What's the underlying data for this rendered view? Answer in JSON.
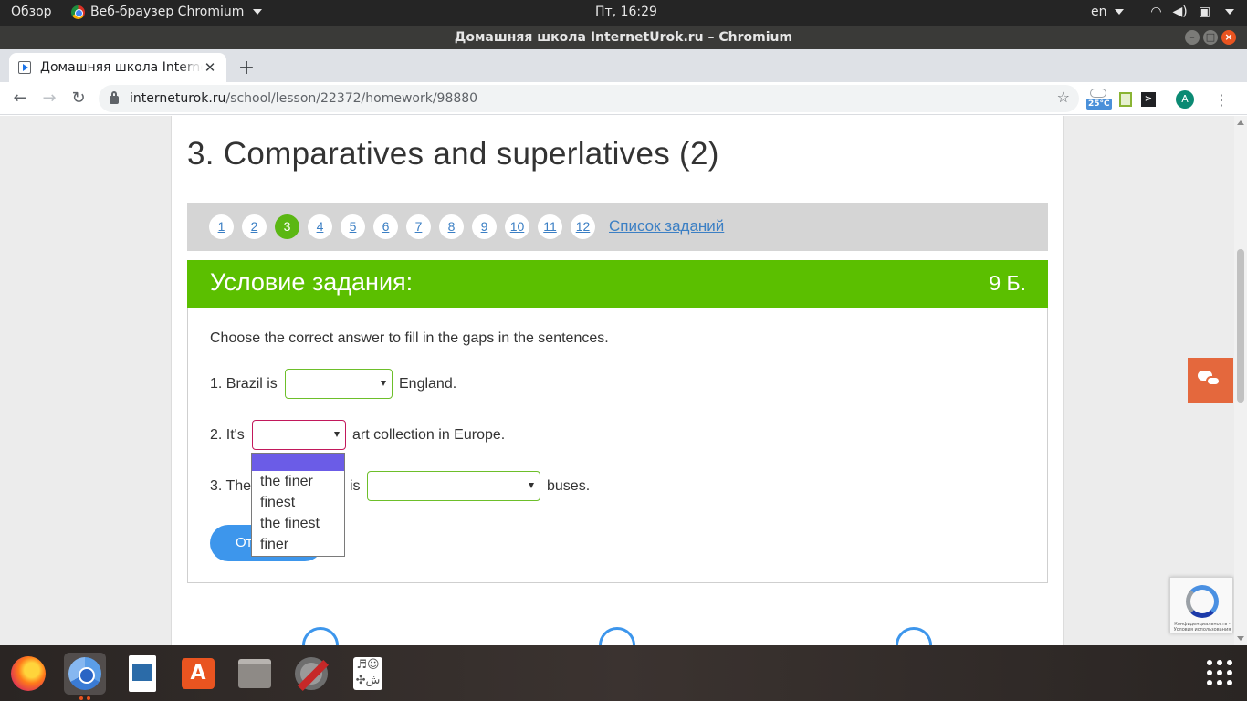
{
  "topbar": {
    "activities": "Обзор",
    "app_menu": "Веб-браузер Chromium",
    "clock": "Пт, 16:29",
    "lang": "en"
  },
  "window": {
    "title": "Домашняя школа InternetUrok.ru – Chromium"
  },
  "browser": {
    "tab_title": "Домашняя школа InternetUrok.ru",
    "url_host": "interneturok.ru",
    "url_path": "/school/lesson/22372/homework/98880",
    "weather_temp": "25°C",
    "avatar_letter": "A"
  },
  "page": {
    "lesson_title": "3. Comparatives and superlatives (2)",
    "pages": [
      "1",
      "2",
      "3",
      "4",
      "5",
      "6",
      "7",
      "8",
      "9",
      "10",
      "11",
      "12"
    ],
    "active_page": "3",
    "task_list_link": "Список заданий",
    "task_label": "Условие задания:",
    "task_points": "9 Б.",
    "instruction": "Choose the correct answer to fill in the gaps in the sentences.",
    "q1_before": "1. Brazil is",
    "q1_after": "England.",
    "q2_before": "2. It's",
    "q2_after": "art collection in Europe.",
    "q3_before": "3. The",
    "q3_mid": "is",
    "q3_after": "buses.",
    "submit_label": "От",
    "dropdown_options": [
      "the finer",
      "finest",
      "the finest",
      "finer"
    ]
  },
  "recaptcha": {
    "text": "Конфиденциальность - Условия использования"
  },
  "colors": {
    "accent_green": "#5bbf00",
    "link_blue": "#3b7fc4",
    "button_blue": "#3d96ec",
    "chat_orange": "#e4683d"
  }
}
